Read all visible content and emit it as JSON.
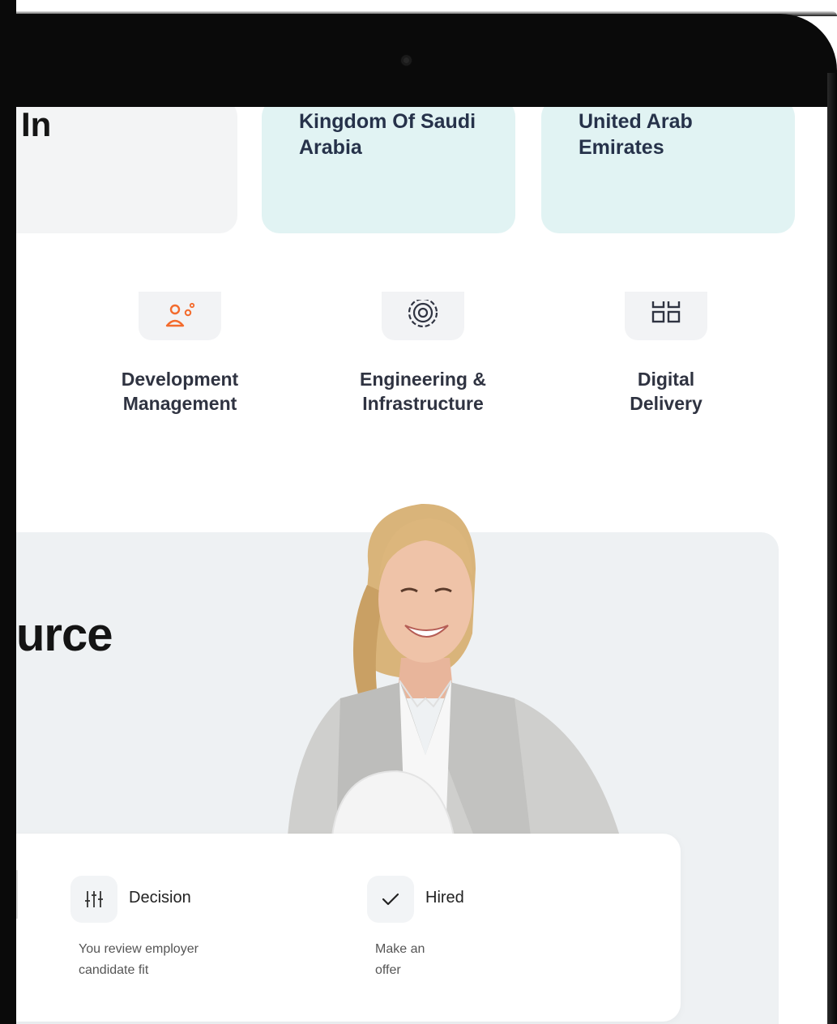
{
  "locations": {
    "partial_heading": "In",
    "cards": [
      {
        "name": "Kingdom Of Saudi Arabia"
      },
      {
        "name": "United Arab Emirates"
      }
    ]
  },
  "services": [
    {
      "label": "Development Management",
      "icon": "person-gear-icon"
    },
    {
      "label": "Engineering & Infrastructure",
      "icon": "gear-cog-icon"
    },
    {
      "label": "Digital Delivery",
      "icon": "grid-icon"
    }
  ],
  "hero": {
    "partial_title": "urce"
  },
  "steps": [
    {
      "label": "Decision",
      "description": "You review employer candidate fit",
      "icon": "sliders-icon"
    },
    {
      "label": "Hired",
      "description": "Make an offer",
      "icon": "check-icon"
    }
  ],
  "colors": {
    "accent_orange": "#f36b2d",
    "card_teal": "#e1f3f3",
    "card_grey": "#f3f4f5",
    "heading": "#26324a"
  }
}
